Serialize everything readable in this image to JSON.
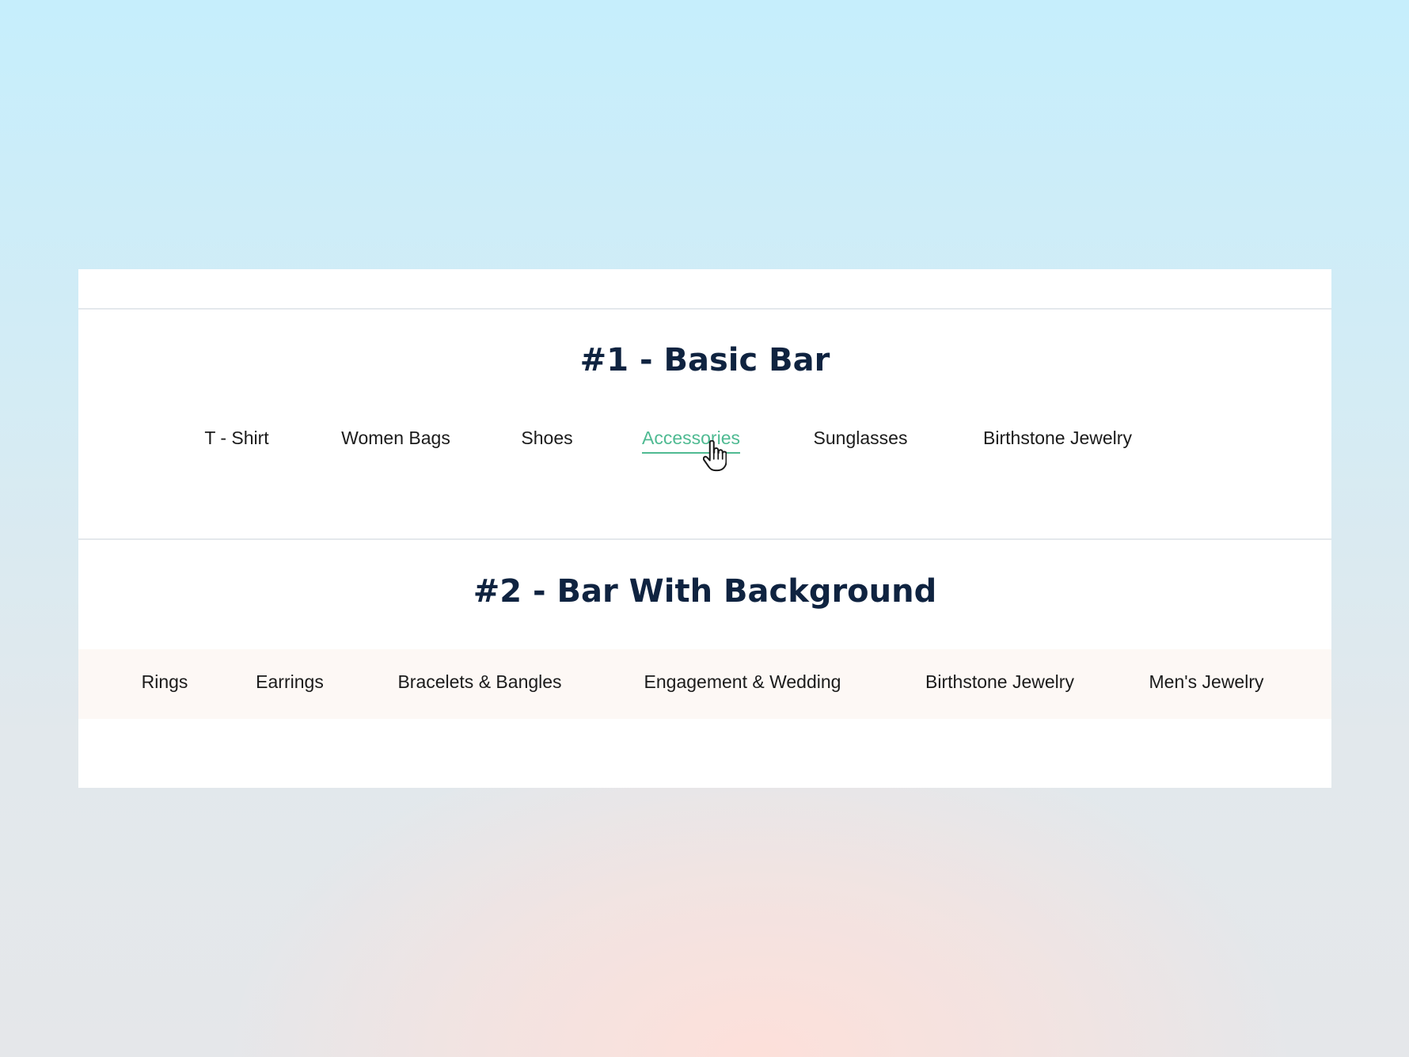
{
  "section1": {
    "title": "#1 - Basic Bar",
    "items": [
      {
        "label": "T - Shirt"
      },
      {
        "label": "Women Bags"
      },
      {
        "label": "Shoes"
      },
      {
        "label": "Accessories",
        "active": true
      },
      {
        "label": "Sunglasses"
      },
      {
        "label": "Birthstone Jewelry"
      }
    ]
  },
  "section2": {
    "title": "#2 - Bar With Background",
    "items": [
      {
        "label": "Rings"
      },
      {
        "label": "Earrings"
      },
      {
        "label": "Bracelets & Bangles"
      },
      {
        "label": "Engagement & Wedding"
      },
      {
        "label": "Birthstone Jewelry"
      },
      {
        "label": "Men's Jewelry"
      }
    ]
  },
  "colors": {
    "title": "#0f2340",
    "link": "#1b1b1b",
    "active": "#4fba92",
    "bar_background": "#fdf8f5"
  },
  "cursor_icon": "hand-pointer-icon"
}
